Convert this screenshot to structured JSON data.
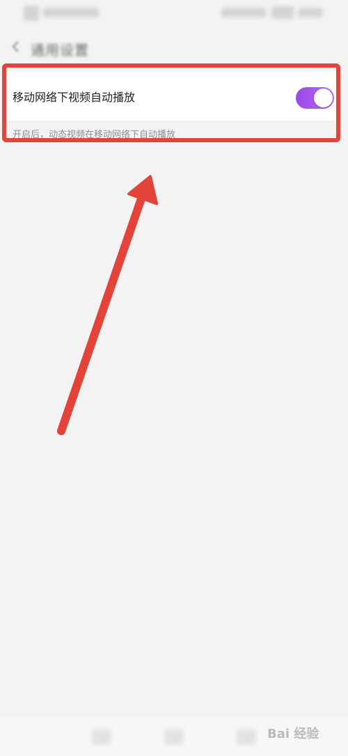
{
  "header": {
    "title": "通用设置"
  },
  "setting": {
    "label": "移动网络下视频自动播放",
    "description": "开启后，动态视频在移动网络下自动播放",
    "enabled": true
  },
  "watermark": {
    "text": "Bai 经验"
  },
  "colors": {
    "highlight": "#e4433a",
    "toggle": "#a855ee",
    "background": "#f3f3f3"
  }
}
